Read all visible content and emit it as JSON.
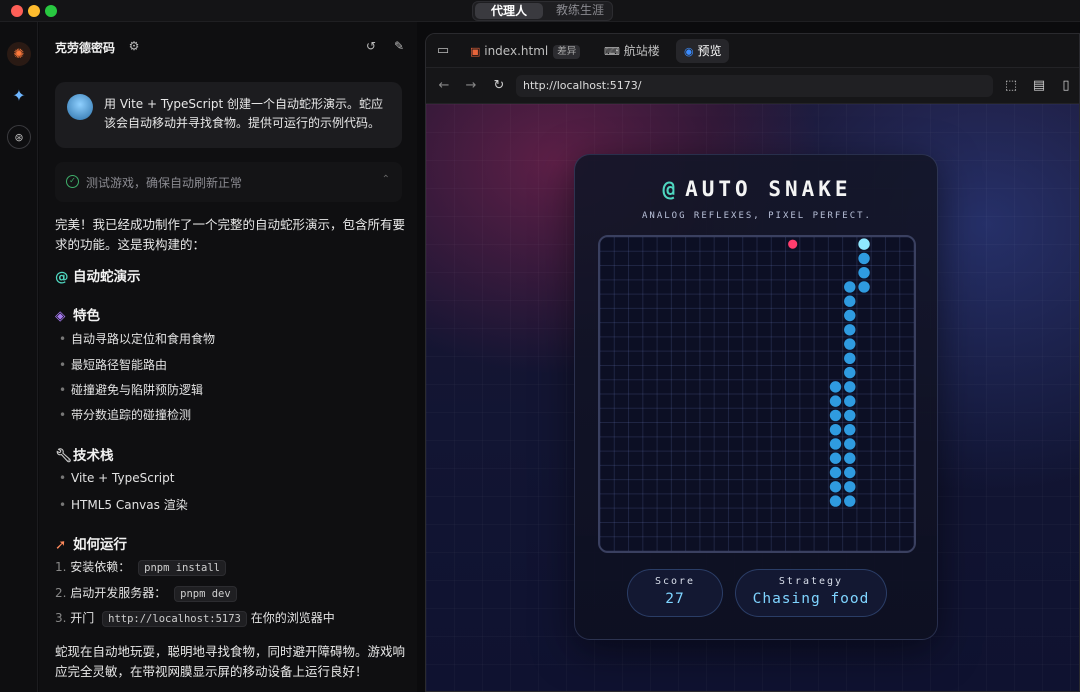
{
  "window": {
    "mode_tabs": [
      {
        "label": "代理人",
        "active": true
      },
      {
        "label": "教练生涯",
        "active": false
      }
    ]
  },
  "rail": {
    "icons": [
      "spark-logo-icon",
      "gemini-star-icon",
      "openai-icon"
    ]
  },
  "chat": {
    "title": "克劳德密码",
    "user_message": "用 Vite + TypeScript 创建一个自动蛇形演示。蛇应该会自动移动并寻找食物。提供可运行的示例代码。",
    "task": "测试游戏，确保自动刷新正常",
    "intro": "完美！我已经成功制作了一个完整的自动蛇形演示，包含所有要求的功能。这是我构建的：",
    "heading_main": "自动蛇演示",
    "heading_features": "特色",
    "features": [
      "自动寻路以定位和食用食物",
      "最短路径智能路由",
      "碰撞避免与陷阱预防逻辑",
      "带分数追踪的碰撞检测"
    ],
    "heading_stack": "技术栈",
    "stack": [
      "Vite + TypeScript",
      "HTML5 Canvas 渲染"
    ],
    "heading_run": "如何运行",
    "steps": [
      {
        "num": "1.",
        "text": "安装依赖：",
        "code": "pnpm install",
        "after": ""
      },
      {
        "num": "2.",
        "text": "启动开发服务器：",
        "code": "pnpm dev",
        "after": ""
      },
      {
        "num": "3.",
        "text": "开门",
        "code": "http://localhost:5173",
        "after": "在你的浏览器中"
      }
    ],
    "outro": "蛇现在自动地玩耍，聪明地寻找食物，同时避开障碍物。游戏响应完全灵敏，在带视网膜显示屏的移动设备上运行良好！"
  },
  "browser": {
    "tabs": [
      {
        "label": "index.html",
        "badge": "差异",
        "active": false
      },
      {
        "label": "航站楼",
        "badge": "",
        "active": false
      },
      {
        "label": "预览",
        "badge": "",
        "active": true
      }
    ],
    "url": "http://localhost:5173/"
  },
  "game": {
    "title": "AUTO SNAKE",
    "subtitle": "ANALOG REFLEXES, PIXEL PERFECT.",
    "score_label": "Score",
    "score_value": "27",
    "strategy_label": "Strategy",
    "strategy_value": "Chasing food",
    "grid_size": 22,
    "food": [
      13,
      0
    ],
    "snake": [
      [
        18,
        0
      ],
      [
        18,
        1
      ],
      [
        18,
        2
      ],
      [
        18,
        3
      ],
      [
        17,
        3
      ],
      [
        17,
        4
      ],
      [
        17,
        5
      ],
      [
        17,
        6
      ],
      [
        17,
        7
      ],
      [
        17,
        8
      ],
      [
        17,
        9
      ],
      [
        17,
        10
      ],
      [
        17,
        11
      ],
      [
        17,
        12
      ],
      [
        17,
        13
      ],
      [
        17,
        14
      ],
      [
        17,
        15
      ],
      [
        17,
        16
      ],
      [
        17,
        17
      ],
      [
        17,
        18
      ],
      [
        16,
        18
      ],
      [
        16,
        17
      ],
      [
        16,
        16
      ],
      [
        16,
        15
      ],
      [
        16,
        14
      ],
      [
        16,
        13
      ],
      [
        16,
        12
      ],
      [
        16,
        11
      ],
      [
        16,
        10
      ]
    ],
    "colors": {
      "snake_head": "#8fe8ff",
      "snake_body": "#2f9be0",
      "food": "#ff3d6e",
      "accent": "#4fd6c0"
    }
  }
}
